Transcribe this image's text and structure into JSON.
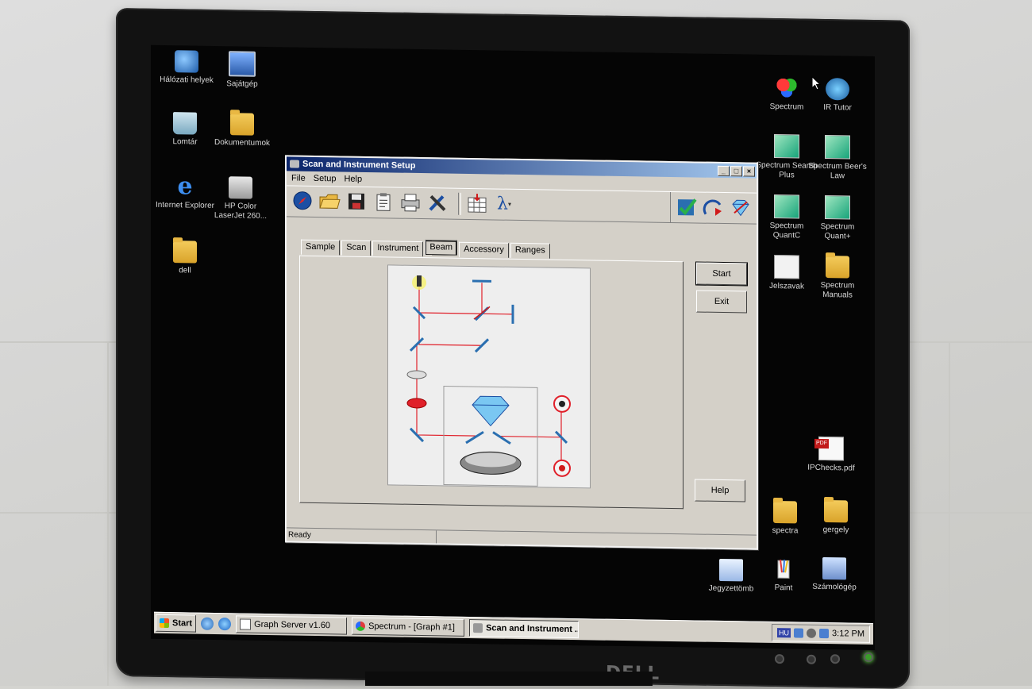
{
  "desktop": {
    "left_icons": [
      {
        "label": "Hálózati helyek",
        "icon": "network-places-icon"
      },
      {
        "label": "Sajátgép",
        "icon": "my-computer-icon"
      },
      {
        "label": "Lomtár",
        "icon": "recycle-bin-icon"
      },
      {
        "label": "Dokumentumok",
        "icon": "documents-icon"
      },
      {
        "label": "Internet Explorer",
        "icon": "internet-explorer-icon"
      },
      {
        "label": "HP Color LaserJet 260...",
        "icon": "printer-icon"
      },
      {
        "label": "dell",
        "icon": "folder-icon"
      }
    ],
    "right_icons": [
      {
        "label": "Spectrum",
        "icon": "spectrum-icon"
      },
      {
        "label": "IR Tutor",
        "icon": "ir-tutor-icon"
      },
      {
        "label": "Spectrum Search Plus",
        "icon": "spectrum-search-plus-icon"
      },
      {
        "label": "Spectrum Beer's Law",
        "icon": "spectrum-beers-law-icon"
      },
      {
        "label": "Spectrum QuantC",
        "icon": "spectrum-quantc-icon"
      },
      {
        "label": "Spectrum Quant+",
        "icon": "spectrum-quant-plus-icon"
      },
      {
        "label": "Jelszavak",
        "icon": "document-icon"
      },
      {
        "label": "Spectrum Manuals",
        "icon": "folder-icon"
      },
      {
        "label": "IPChecks.pdf",
        "icon": "pdf-icon"
      },
      {
        "label": "spectra",
        "icon": "folder-icon"
      },
      {
        "label": "gergely",
        "icon": "folder-icon"
      },
      {
        "label": "Jegyzettömb",
        "icon": "notepad-icon"
      },
      {
        "label": "Paint",
        "icon": "paint-icon"
      },
      {
        "label": "Számológép",
        "icon": "calculator-icon"
      }
    ]
  },
  "window": {
    "title": "Scan and Instrument Setup",
    "menu": [
      "File",
      "Setup",
      "Help"
    ],
    "toolbar_icons": [
      "compass-icon",
      "open-folder-icon",
      "save-icon",
      "clipboard-icon",
      "printer-icon",
      "tools-icon",
      "table-icon",
      "lambda-icon",
      "check-icon",
      "arc-arrow-icon",
      "diamond-icon"
    ],
    "tabs": [
      "Sample",
      "Scan",
      "Instrument",
      "Beam",
      "Accessory",
      "Ranges"
    ],
    "active_tab": "Beam",
    "buttons": {
      "start": "Start",
      "exit": "Exit",
      "help": "Help"
    },
    "status": "Ready",
    "lambda_symbol": "λ"
  },
  "taskbar": {
    "start_label": "Start",
    "tasks": [
      {
        "label": "Graph Server v1.60",
        "active": false
      },
      {
        "label": "Spectrum - [Graph #1]",
        "active": false
      },
      {
        "label": "Scan and Instrument ...",
        "active": true
      }
    ],
    "language": "HU",
    "clock": "3:12 PM"
  },
  "monitor": {
    "brand": "DELL"
  },
  "colors": {
    "beam": "#e0202a",
    "mirror": "#2a6fb0",
    "title_start": "#0a246a",
    "title_end": "#a6caf0"
  }
}
